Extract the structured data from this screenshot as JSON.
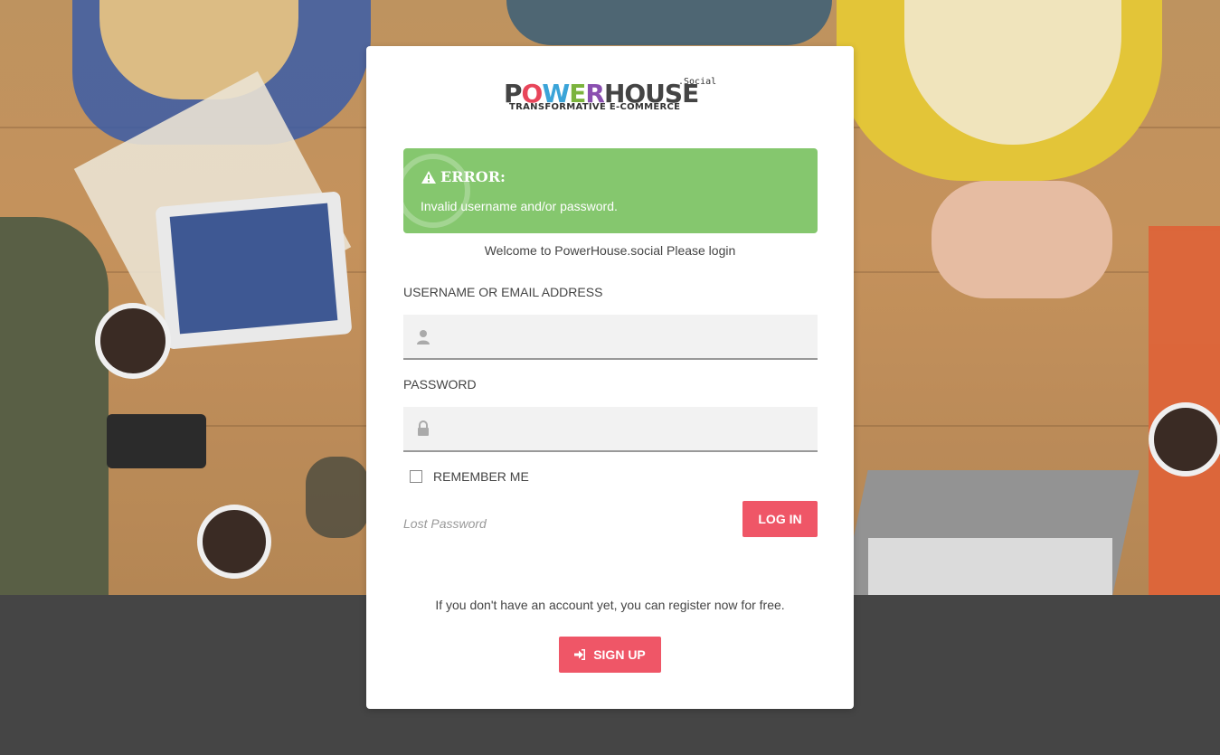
{
  "logo": {
    "brand_letters": [
      "P",
      "O",
      "W",
      "E",
      "R",
      "HOUSE"
    ],
    "suffix": ".Social",
    "tagline": "TRANSFORMATIVE E-COMMERCE"
  },
  "alert": {
    "icon": "warning-icon",
    "title": "ERROR:",
    "message": "Invalid username and/or password.",
    "color": "#85c76e"
  },
  "welcome_text": "Welcome to PowerHouse.social Please login",
  "username": {
    "label": "USERNAME OR EMAIL ADDRESS",
    "icon": "user-icon",
    "value": ""
  },
  "password": {
    "label": "PASSWORD",
    "icon": "lock-icon",
    "value": ""
  },
  "remember_me": {
    "label": "REMEMBER ME",
    "checked": false
  },
  "lost_password": "Lost Password",
  "login_button": "LOG IN",
  "register_text": "If you don't have an account yet, you can register now for free.",
  "signup_button": {
    "label": "SIGN UP",
    "icon": "sign-in-icon"
  },
  "accent_color": "#ef5667"
}
